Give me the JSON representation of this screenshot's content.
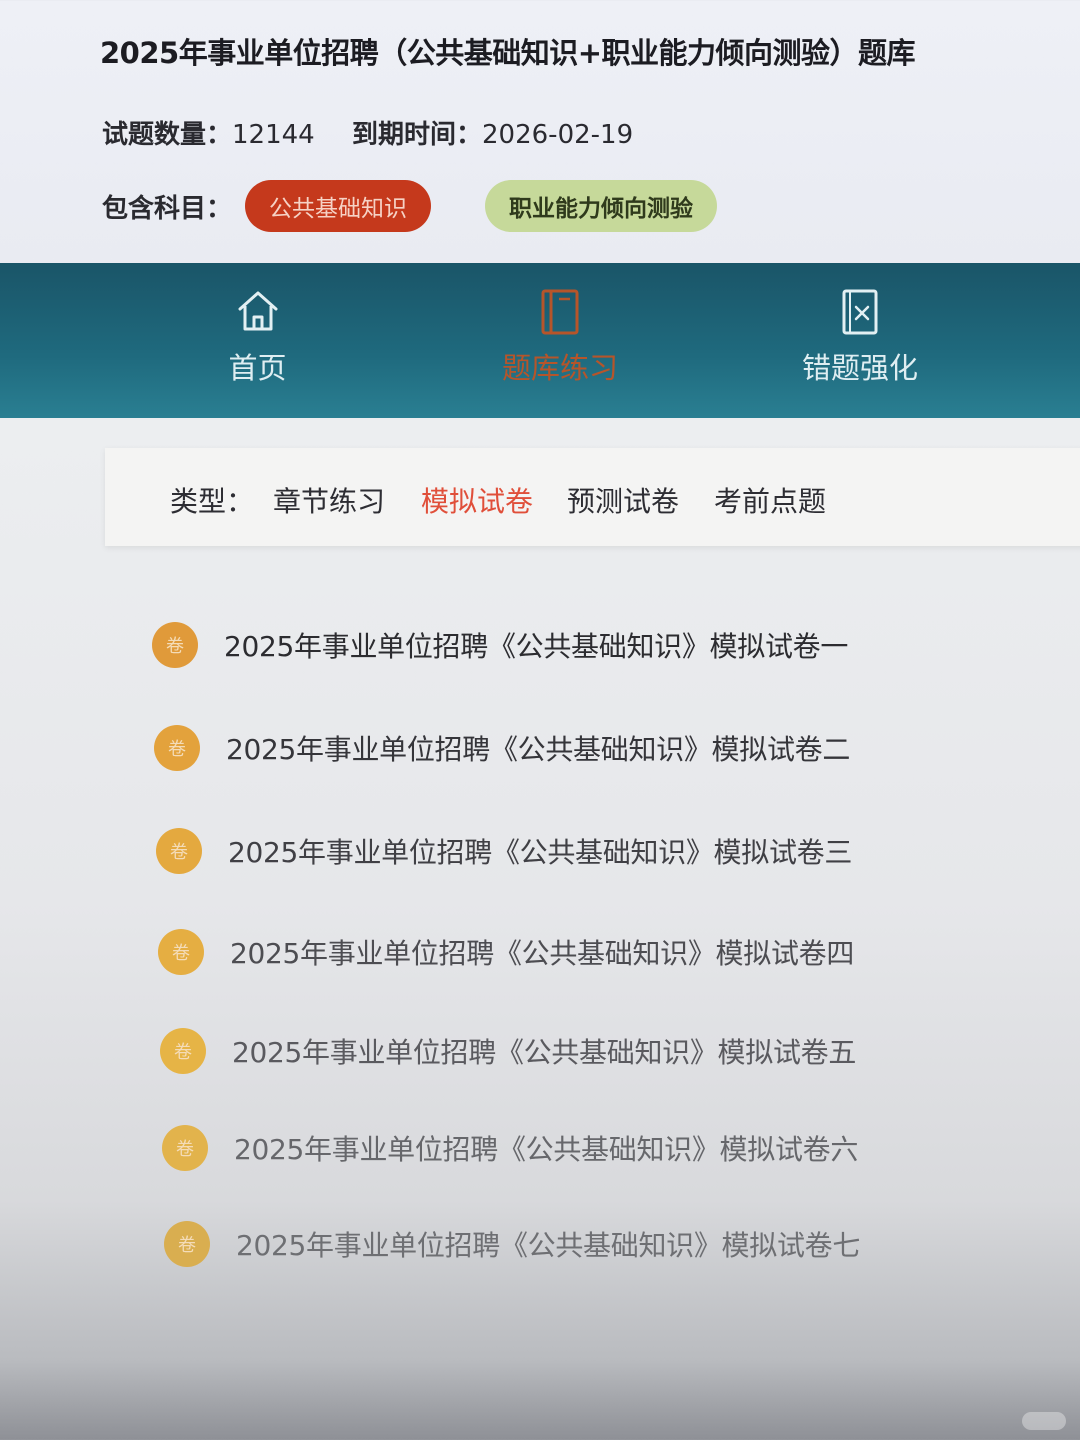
{
  "header": {
    "title": "2025年事业单位招聘（公共基础知识+职业能力倾向测验）题库",
    "question_count_label": "试题数量：",
    "question_count_value": "12144",
    "expiry_label": "到期时间：",
    "expiry_value": "2026-02-19",
    "subjects_label": "包含科目：",
    "subjects": [
      "公共基础知识",
      "职业能力倾向测验"
    ]
  },
  "nav": {
    "items": [
      {
        "label": "首页",
        "icon": "home-icon"
      },
      {
        "label": "题库练习",
        "icon": "book-icon",
        "active": true
      },
      {
        "label": "错题强化",
        "icon": "wrong-question-icon"
      }
    ]
  },
  "filter": {
    "label": "类型：",
    "options": [
      "章节练习",
      "模拟试卷",
      "预测试卷",
      "考前点题"
    ],
    "active": "模拟试卷"
  },
  "papers": {
    "badge": "卷",
    "items": [
      "2025年事业单位招聘《公共基础知识》模拟试卷一",
      "2025年事业单位招聘《公共基础知识》模拟试卷二",
      "2025年事业单位招聘《公共基础知识》模拟试卷三",
      "2025年事业单位招聘《公共基础知识》模拟试卷四",
      "2025年事业单位招聘《公共基础知识》模拟试卷五",
      "2025年事业单位招聘《公共基础知识》模拟试卷六",
      "2025年事业单位招聘《公共基础知识》模拟试卷七"
    ]
  },
  "colors": {
    "nav_bg": "#1f6a7e",
    "active_red": "#e04f3a",
    "chip_red": "#c5391c",
    "chip_green": "#c6d99a",
    "badge_orange": "#e09a3a"
  }
}
